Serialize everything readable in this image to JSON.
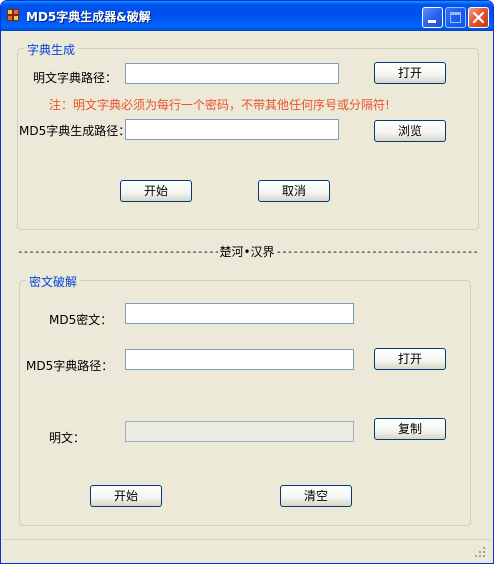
{
  "window": {
    "title": "MD5字典生成器&破解",
    "icons": {
      "app": "app-icon",
      "minimize": "minimize-icon",
      "maximize": "maximize-icon",
      "close": "close-icon"
    }
  },
  "dict_group": {
    "title": "字典生成",
    "plain_path_label": "明文字典路径：",
    "plain_path_value": "",
    "open_button": "打开",
    "note": "注：明文字典必须为每行一个密码，不带其他任何序号或分隔符!",
    "md5_out_label": "MD5字典生成路径：",
    "md5_out_value": "",
    "browse_button": "浏览",
    "start_button": "开始",
    "cancel_button": "取消"
  },
  "divider": {
    "center_text": "楚河•汉界"
  },
  "crack_group": {
    "title": "密文破解",
    "md5_cipher_label": "MD5密文：",
    "md5_cipher_value": "",
    "md5_dict_label": "MD5字典路径：",
    "md5_dict_value": "",
    "open_button": "打开",
    "plaintext_label": "明文：",
    "plaintext_value": "",
    "copy_button": "复制",
    "start_button": "开始",
    "clear_button": "清空"
  },
  "colors": {
    "titlebar": "#0053ee",
    "group_title": "#0046d5",
    "note": "#e8542a",
    "window_bg": "#ece9d8"
  }
}
